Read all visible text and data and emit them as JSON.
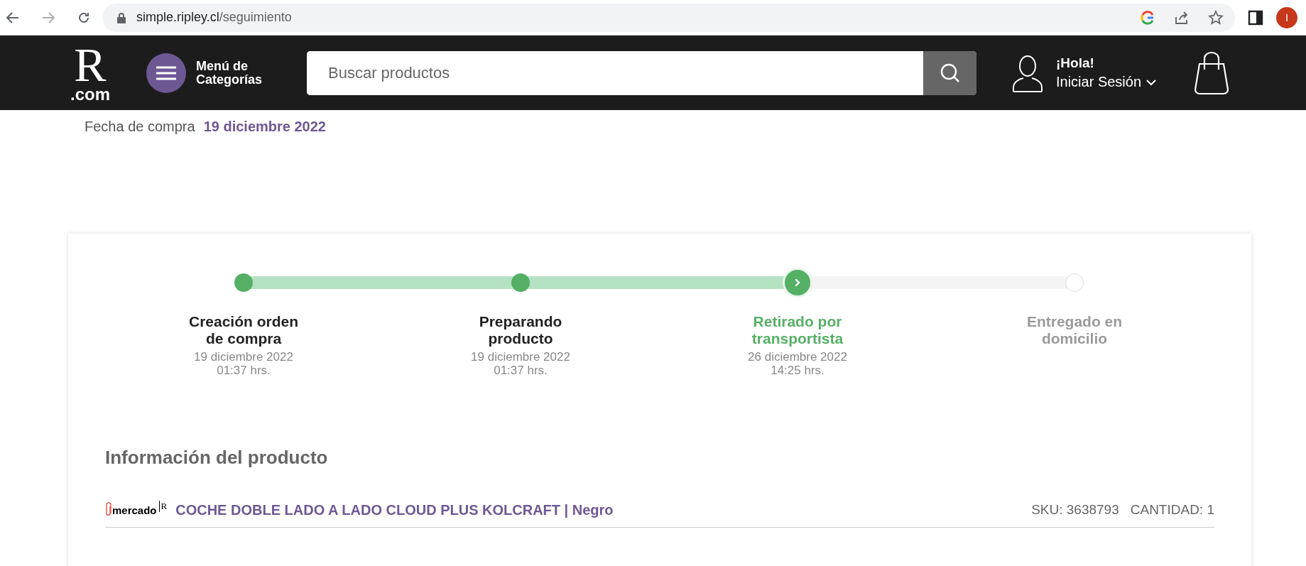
{
  "browser": {
    "url_host": "simple.ripley.cl",
    "url_path": "/seguimiento",
    "profile_initial": "I"
  },
  "header": {
    "logo_letter": "R",
    "logo_suffix": ".com",
    "menu_label": "Menú de Categorías",
    "search": {
      "placeholder": "Buscar productos"
    },
    "greeting": "¡Hola!",
    "login": "Iniciar Sesión"
  },
  "order": {
    "date_label": "Fecha de compra",
    "date_value": "19 diciembre 2022"
  },
  "tracking": {
    "steps": [
      {
        "title": "Creación orden de compra",
        "date": "19 diciembre 2022",
        "time": "01:37 hrs.",
        "kind": "done"
      },
      {
        "title": "Preparando producto",
        "date": "19 diciembre 2022",
        "time": "01:37 hrs.",
        "kind": "done"
      },
      {
        "title": "Retirado por transportista",
        "date": "26 diciembre 2022",
        "time": "14:25 hrs.",
        "kind": "current"
      },
      {
        "title": "Entregado en domicilio",
        "kind": "pending"
      }
    ]
  },
  "product_info": {
    "title": "Información del producto",
    "items": [
      {
        "seller": "mercado",
        "seller_mark": "R",
        "name": "COCHE DOBLE LADO A LADO CLOUD PLUS KOLCRAFT | Negro",
        "sku": "SKU: 3638793",
        "quantity": "CANTIDAD: 1"
      }
    ]
  }
}
